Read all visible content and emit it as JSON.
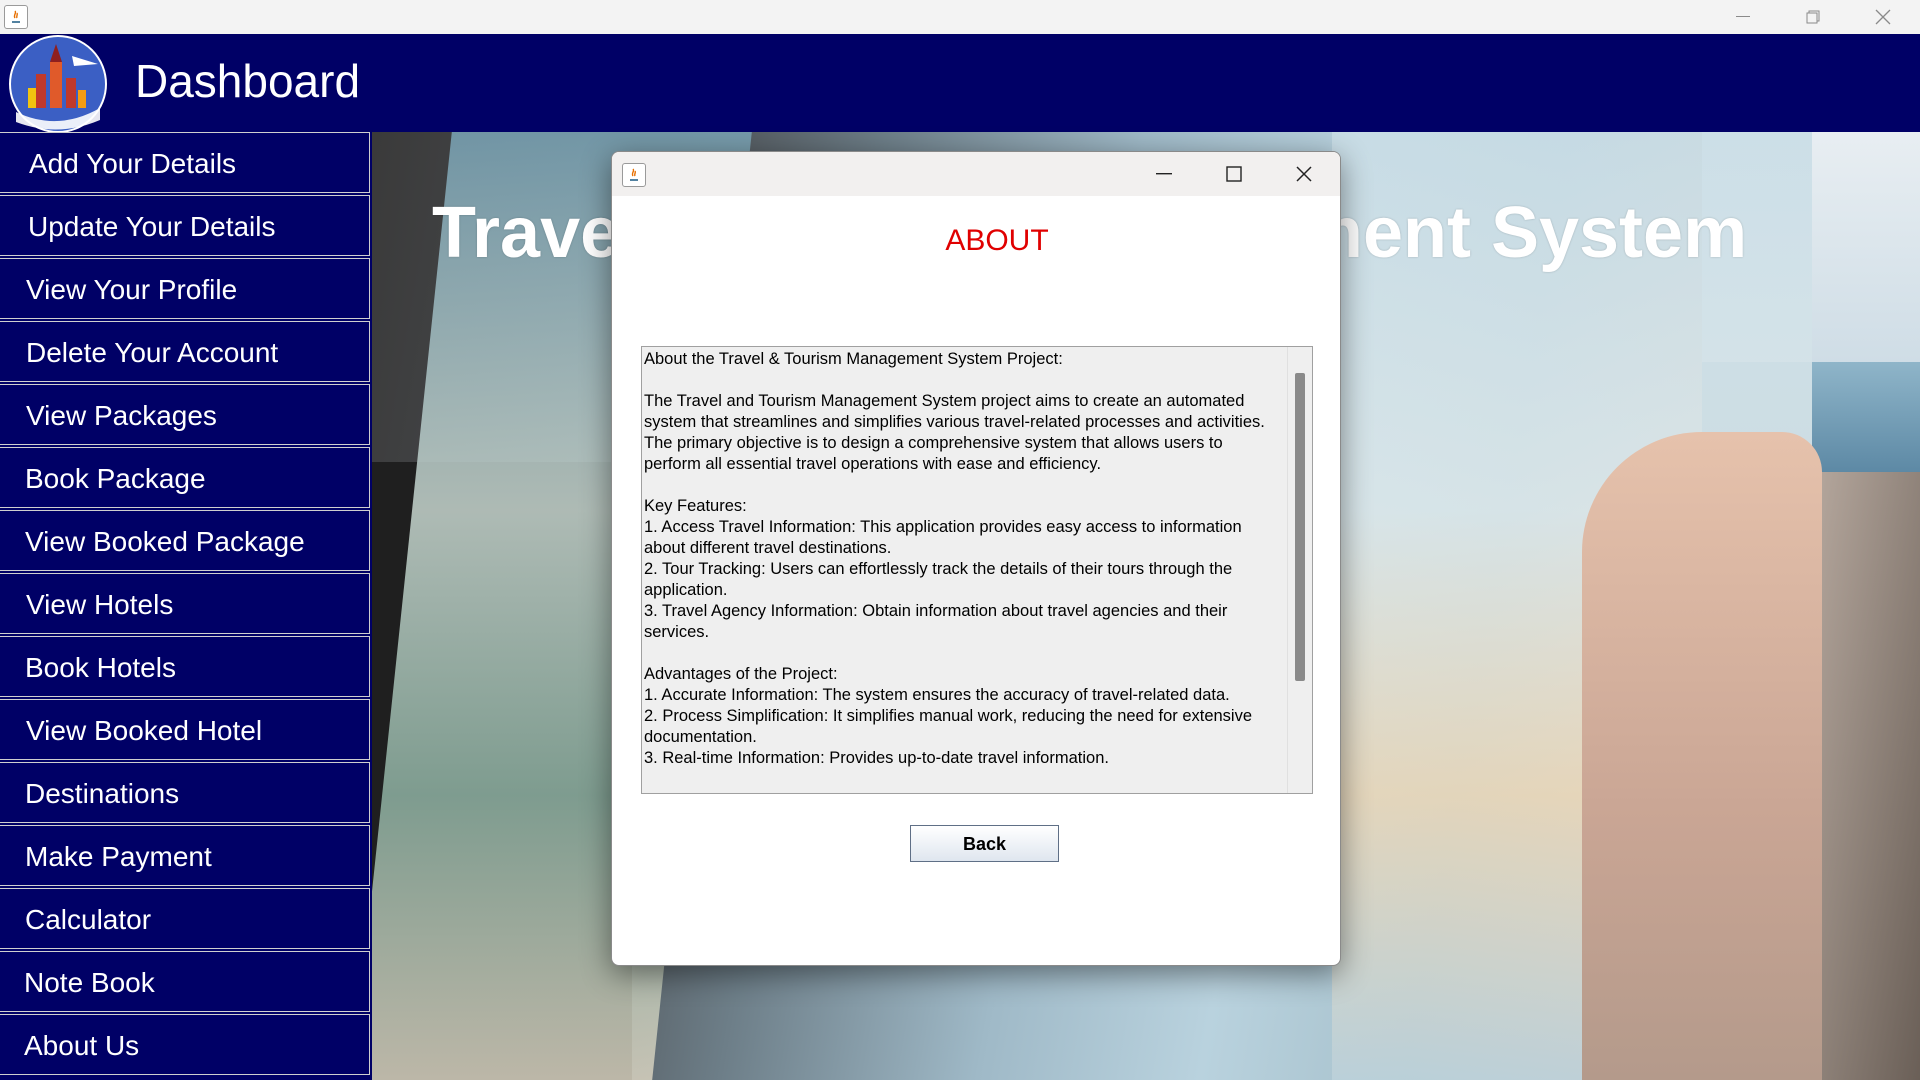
{
  "window": {
    "app_icon": "java-icon",
    "controls": {
      "minimize": "minimize-icon",
      "maximize": "restore-icon",
      "close": "close-icon"
    }
  },
  "header": {
    "title": "Dashboard",
    "logo": "city-globe-logo"
  },
  "sidebar": {
    "items": [
      {
        "label": "Add Your Details"
      },
      {
        "label": "Update Your Details"
      },
      {
        "label": "View Your Profile"
      },
      {
        "label": "Delete Your Account"
      },
      {
        "label": "View Packages"
      },
      {
        "label": "Book Package"
      },
      {
        "label": "View Booked Package"
      },
      {
        "label": "View Hotels"
      },
      {
        "label": "Book Hotels"
      },
      {
        "label": "View Booked Hotel"
      },
      {
        "label": "Destinations"
      },
      {
        "label": "Make Payment"
      },
      {
        "label": "Calculator"
      },
      {
        "label": "Note Book"
      },
      {
        "label": "About Us"
      }
    ]
  },
  "background": {
    "title": "Travel & Tourism Management System"
  },
  "dialog": {
    "heading": "ABOUT",
    "heading_color": "#e00000",
    "text": "About the Travel & Tourism Management System Project:\n\nThe Travel and Tourism Management System project aims to create an automated system that streamlines and simplifies various travel-related processes and activities. The primary objective is to design a comprehensive system that allows users to perform all essential travel operations with ease and efficiency.\n\nKey Features:\n1. Access Travel Information: This application provides easy access to information about different travel destinations.\n2. Tour Tracking: Users can effortlessly track the details of their tours through the application.\n3. Travel Agency Information: Obtain information about travel agencies and their services.\n\nAdvantages of the Project:\n1. Accurate Information: The system ensures the accuracy of travel-related data.\n2. Process Simplification: It simplifies manual work, reducing the need for extensive documentation.\n3. Real-time Information: Provides up-to-date travel information.",
    "back_label": "Back"
  },
  "colors": {
    "header_bg": "#000066",
    "sidebar_bg": "#000066"
  }
}
